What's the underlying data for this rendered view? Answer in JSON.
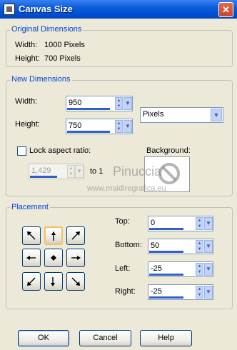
{
  "window": {
    "title": "Canvas Size",
    "close_glyph": "✕"
  },
  "original": {
    "title": "Original Dimensions",
    "width_label": "Width:",
    "width_value": "1000 Pixels",
    "height_label": "Height:",
    "height_value": "700 Pixels"
  },
  "new_dims": {
    "title": "New Dimensions",
    "width_label": "Width:",
    "width_value": "950",
    "height_label": "Height:",
    "height_value": "750",
    "units": "Pixels",
    "lock_label": "Lock aspect ratio:",
    "lock_checked": false,
    "ratio_value": "1,429",
    "ratio_suffix": "to 1",
    "background_label": "Background:"
  },
  "placement": {
    "title": "Placement",
    "top_label": "Top:",
    "top_value": "0",
    "bottom_label": "Bottom:",
    "bottom_value": "50",
    "left_label": "Left:",
    "left_value": "-25",
    "right_label": "Right:",
    "right_value": "-25",
    "selected_anchor": "top-center"
  },
  "watermark": {
    "line1": "Pinuccia",
    "line2": "www.maidiregrafica.eu"
  },
  "buttons": {
    "ok": "OK",
    "cancel": "Cancel",
    "help": "Help"
  },
  "colors": {
    "group_title": "#0046D5",
    "title_bar": "#0A5FD8",
    "progress": "#3161C6",
    "dialog_bg": "#ECE9D8"
  }
}
